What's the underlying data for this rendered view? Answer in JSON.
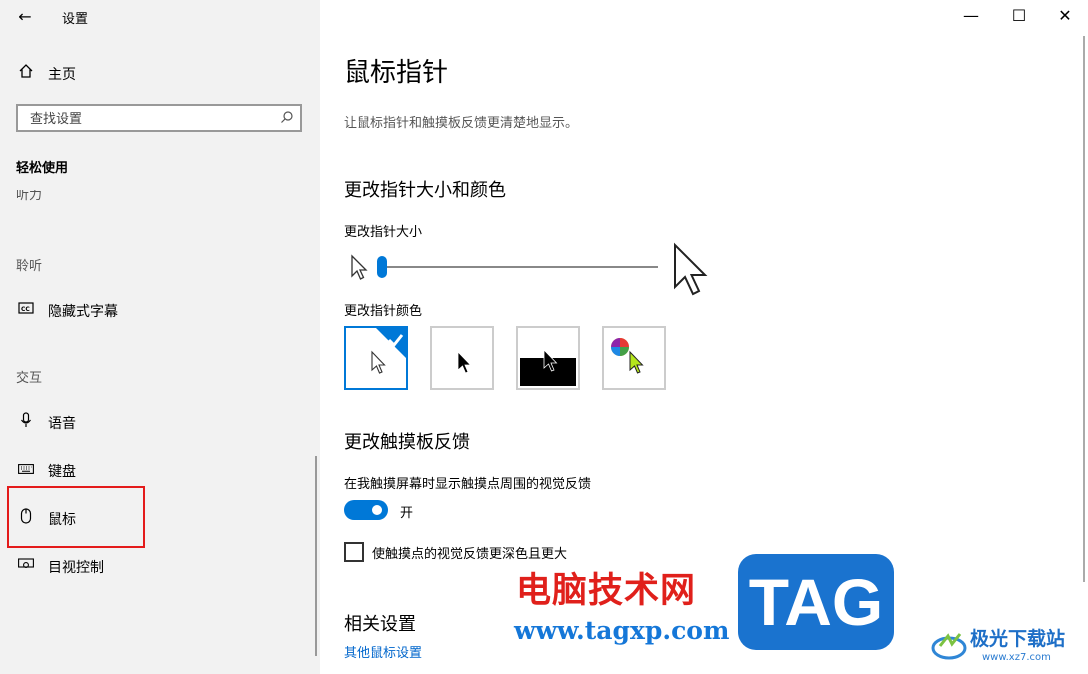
{
  "window": {
    "title": "设置",
    "controls": {
      "minimize": "—",
      "maximize": "☐",
      "close": "✕"
    }
  },
  "sidebar": {
    "home_label": "主页",
    "search_placeholder": "查找设置",
    "category_title": "轻松使用",
    "clipped_item": "听力",
    "sections": [
      {
        "title": "聆听",
        "items": [
          {
            "label": "隐藏式字幕",
            "icon": "closed-caption-icon"
          }
        ]
      },
      {
        "title": "交互",
        "items": [
          {
            "label": "语音",
            "icon": "microphone-icon"
          },
          {
            "label": "键盘",
            "icon": "keyboard-icon"
          },
          {
            "label": "鼠标",
            "icon": "mouse-icon",
            "selected": true
          },
          {
            "label": "目视控制",
            "icon": "eye-control-icon"
          }
        ]
      }
    ]
  },
  "main": {
    "title": "鼠标指针",
    "description": "让鼠标指针和触摸板反馈更清楚地显示。",
    "pointer_section": {
      "heading": "更改指针大小和颜色",
      "size_label": "更改指针大小",
      "size_value": 1,
      "size_min": 1,
      "size_max": 15,
      "color_label": "更改指针颜色",
      "color_options": [
        "white",
        "black",
        "inverted",
        "custom"
      ],
      "selected_color": "white"
    },
    "touch_section": {
      "heading": "更改触摸板反馈",
      "feedback_label": "在我触摸屏幕时显示触摸点周围的视觉反馈",
      "toggle_state": "开",
      "toggle_on": true,
      "darker_label": "使触摸点的视觉反馈更深色且更大",
      "darker_checked": false
    },
    "related": {
      "heading": "相关设置",
      "link": "其他鼠标设置"
    }
  },
  "watermarks": {
    "cn_text": "电脑技术网",
    "url_text": "www.tagxp.com",
    "tag_text": "TAG",
    "site2_text": "极光下载站",
    "site2_url": "www.xz7.com"
  },
  "colors": {
    "accent": "#0078d7",
    "highlight": "#e41b1b"
  }
}
